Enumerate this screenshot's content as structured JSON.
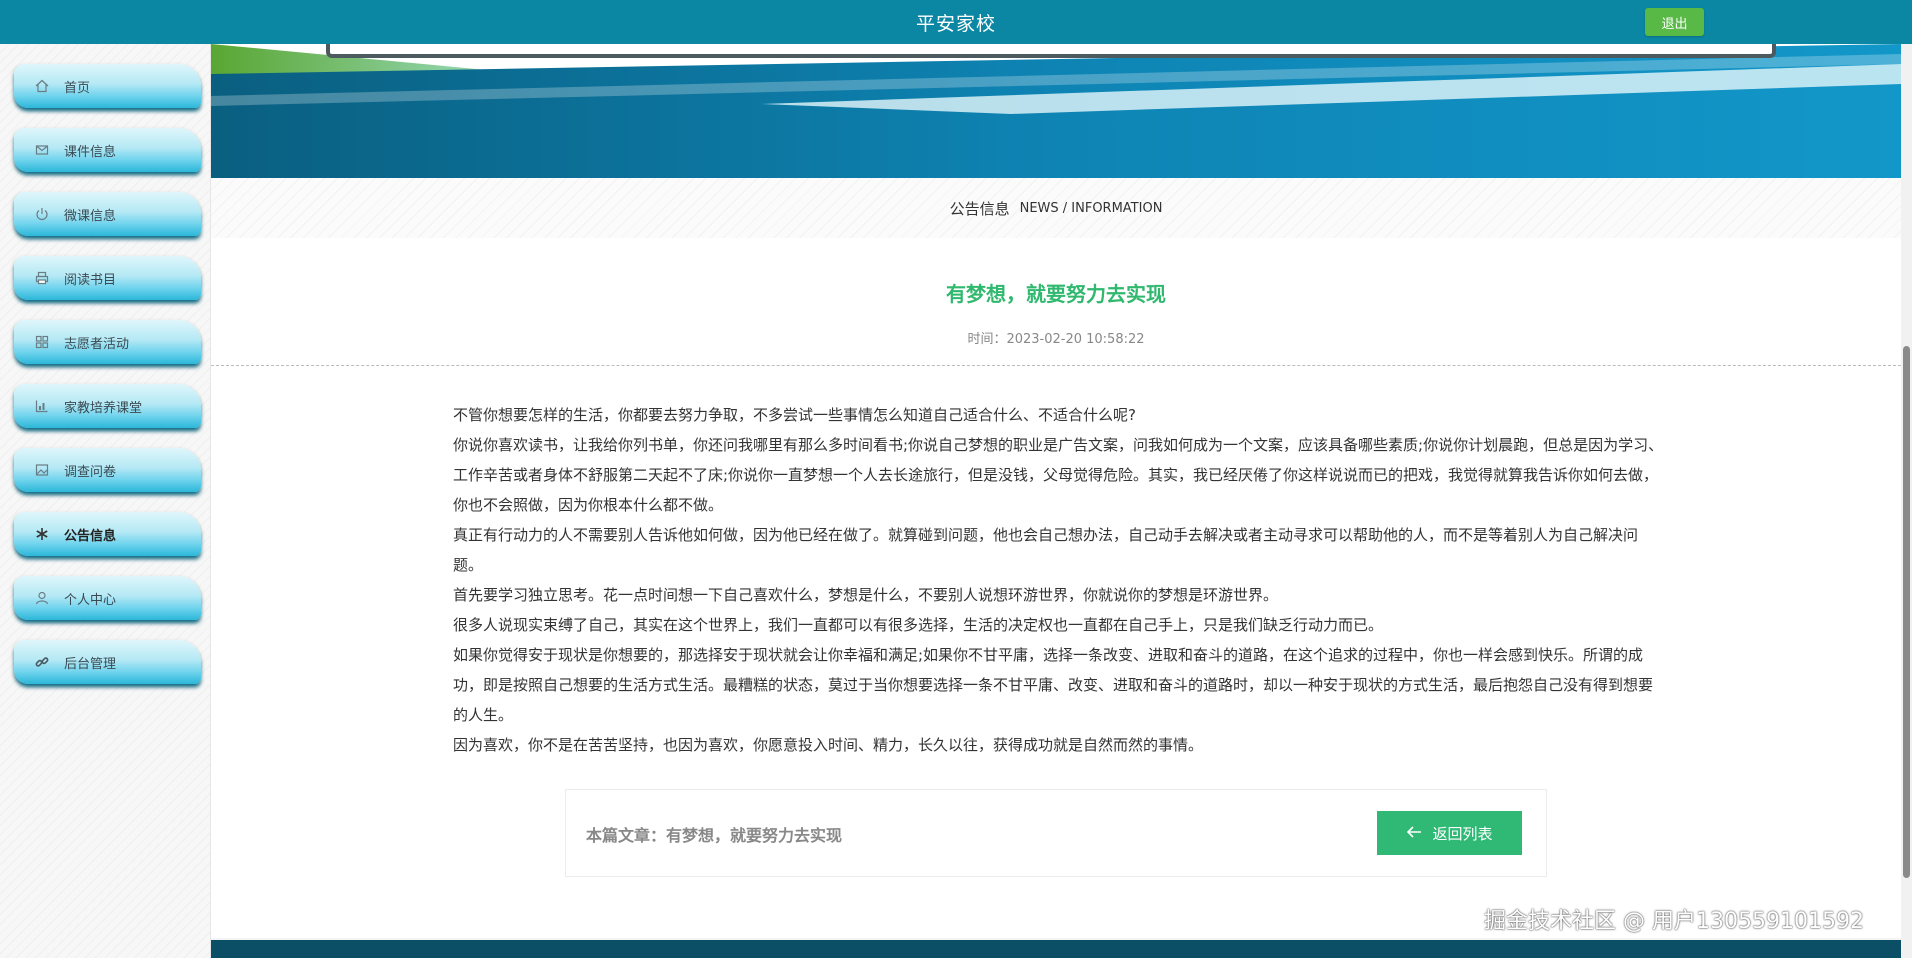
{
  "header": {
    "title": "平安家校",
    "logout_label": "退出"
  },
  "sidebar": {
    "items": [
      {
        "label": "首页",
        "icon": "home-icon"
      },
      {
        "label": "课件信息",
        "icon": "mail-icon"
      },
      {
        "label": "微课信息",
        "icon": "power-icon"
      },
      {
        "label": "阅读书目",
        "icon": "printer-icon"
      },
      {
        "label": "志愿者活动",
        "icon": "grid-icon"
      },
      {
        "label": "家教培养课堂",
        "icon": "chart-icon"
      },
      {
        "label": "调查问卷",
        "icon": "image-icon"
      },
      {
        "label": "公告信息",
        "icon": "snowflake-icon",
        "active": true
      },
      {
        "label": "个人中心",
        "icon": "user-icon"
      },
      {
        "label": "后台管理",
        "icon": "link-icon"
      }
    ]
  },
  "section": {
    "title_cn": "公告信息",
    "title_en": "NEWS / INFORMATION"
  },
  "article": {
    "title": "有梦想，就要努力去实现",
    "time": "时间：2023-02-20 10:58:22",
    "paragraphs": [
      "不管你想要怎样的生活，你都要去努力争取，不多尝试一些事情怎么知道自己适合什么、不适合什么呢?",
      "你说你喜欢读书，让我给你列书单，你还问我哪里有那么多时间看书;你说自己梦想的职业是广告文案，问我如何成为一个文案，应该具备哪些素质;你说你计划晨跑，但总是因为学习、工作辛苦或者身体不舒服第二天起不了床;你说你一直梦想一个人去长途旅行，但是没钱，父母觉得危险。其实，我已经厌倦了你这样说说而已的把戏，我觉得就算我告诉你如何去做，你也不会照做，因为你根本什么都不做。",
      "真正有行动力的人不需要别人告诉他如何做，因为他已经在做了。就算碰到问题，他也会自己想办法，自己动手去解决或者主动寻求可以帮助他的人，而不是等着别人为自己解决问题。",
      "首先要学习独立思考。花一点时间想一下自己喜欢什么，梦想是什么，不要别人说想环游世界，你就说你的梦想是环游世界。",
      "很多人说现实束缚了自己，其实在这个世界上，我们一直都可以有很多选择，生活的决定权也一直都在自己手上，只是我们缺乏行动力而已。",
      "如果你觉得安于现状是你想要的，那选择安于现状就会让你幸福和满足;如果你不甘平庸，选择一条改变、进取和奋斗的道路，在这个追求的过程中，你也一样会感到快乐。所谓的成功，即是按照自己想要的生活方式生活。最糟糕的状态，莫过于当你想要选择一条不甘平庸、改变、进取和奋斗的道路时，却以一种安于现状的方式生活，最后抱怨自己没有得到想要的人生。",
      "因为喜欢，你不是在苦苦坚持，也因为喜欢，你愿意投入时间、精力，长久以往，获得成功就是自然而然的事情。"
    ],
    "current_label": "本篇文章：有梦想，就要努力去实现",
    "back_label": "返回列表"
  },
  "watermark": "掘金技术社区 @ 用户130559101592"
}
